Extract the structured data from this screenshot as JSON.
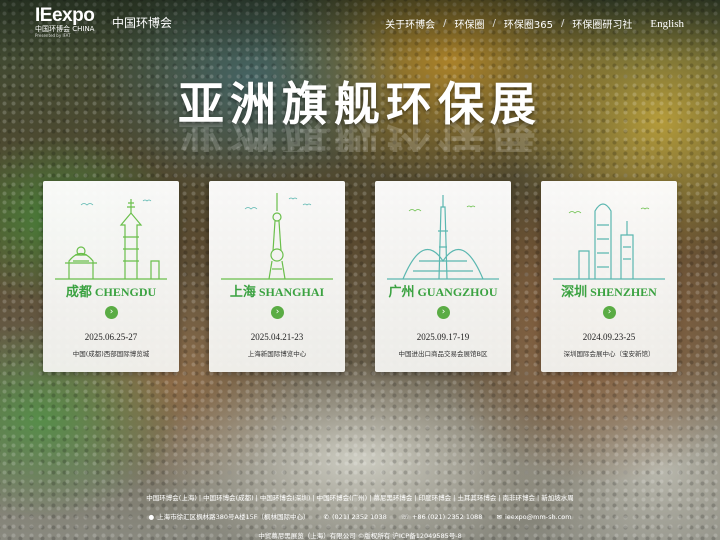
{
  "header": {
    "logo_text": "IEexpo",
    "logo_sub": "中国环博会 CHINA",
    "logo_tagline": "Presented by IFAT",
    "brand": "中国环博会",
    "nav": [
      "关于环博会",
      "环保圈",
      "环保圈365",
      "环保圈研习社"
    ],
    "nav_separator": "/",
    "language": "English"
  },
  "hero": {
    "title": "亚洲旗舰环保展"
  },
  "cards": [
    {
      "city_cn": "成都",
      "city_en": "CHENGDU",
      "date": "2025.06.25-27",
      "venue": "中国(成都)西部国际博览城",
      "arrow": "›",
      "illustration": "chengdu-skyline-icon"
    },
    {
      "city_cn": "上海",
      "city_en": "SHANGHAI",
      "date": "2025.04.21-23",
      "venue": "上海新国际博览中心",
      "arrow": "›",
      "illustration": "shanghai-skyline-icon"
    },
    {
      "city_cn": "广州",
      "city_en": "GUANGZHOU",
      "date": "2025.09.17-19",
      "venue": "中国进出口商品交易会展馆B区",
      "arrow": "›",
      "illustration": "guangzhou-skyline-icon"
    },
    {
      "city_cn": "深圳",
      "city_en": "SHENZHEN",
      "date": "2024.09.23-25",
      "venue": "深圳国际会展中心（宝安新馆）",
      "arrow": "›",
      "illustration": "shenzhen-skyline-icon"
    }
  ],
  "footer": {
    "links": [
      "中国环博会(上海)",
      "中国环博会(成都)",
      "中国环博会(深圳)",
      "中国环博会(广州)",
      "慕尼黑环博会",
      "印度环博会",
      "土耳其环博会",
      "南非环博会",
      "新加坡水周"
    ],
    "link_separator": "|",
    "address": "上海市徐汇区枫林路380号A楼15F（枫林国际中心）",
    "phone": "(021) 2352 1038",
    "fax": "+86 (021) 2352 1088",
    "email": "ieexpo@mm-sh.com",
    "copyright": "中贸慕尼黑展览（上海）有限公司 ©版权所有 沪ICP备12049585号-8"
  },
  "colors": {
    "accent_green": "#3ba241",
    "illustration_green": "#6abf4b",
    "illustration_teal": "#5bb7b0"
  }
}
